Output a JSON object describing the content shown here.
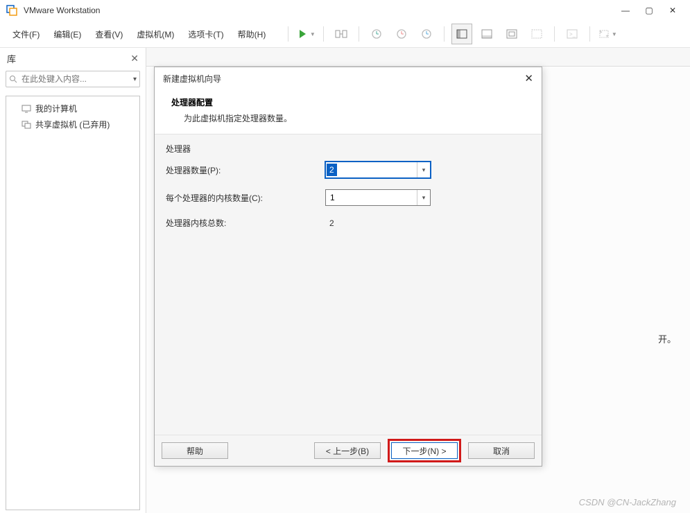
{
  "app": {
    "title": "VMware Workstation"
  },
  "win_controls": {
    "min": "—",
    "max": "▢",
    "close": "✕"
  },
  "menu": {
    "file": "文件(F)",
    "edit": "编辑(E)",
    "view": "查看(V)",
    "vm": "虚拟机(M)",
    "tabs": "选项卡(T)",
    "help": "帮助(H)"
  },
  "sidebar": {
    "title": "库",
    "close": "✕",
    "search_placeholder": "在此处键入内容...",
    "dropdown": "▾",
    "items": [
      {
        "label": "我的计算机",
        "icon": "monitor"
      },
      {
        "label": "共享虚拟机 (已弃用)",
        "icon": "shared"
      }
    ]
  },
  "behind": {
    "fragment": "开。"
  },
  "dialog": {
    "title": "新建虚拟机向导",
    "close": "✕",
    "heading": "处理器配置",
    "subheading": "为此虚拟机指定处理器数量。",
    "group_title": "处理器",
    "proc_count_label": "处理器数量(P):",
    "proc_count_value": "2",
    "cores_label": "每个处理器的内核数量(C):",
    "cores_value": "1",
    "total_label": "处理器内核总数:",
    "total_value": "2",
    "buttons": {
      "help": "帮助",
      "back": "< 上一步(B)",
      "next": "下一步(N) >",
      "cancel": "取消"
    }
  },
  "watermark": "CSDN @CN-JackZhang"
}
